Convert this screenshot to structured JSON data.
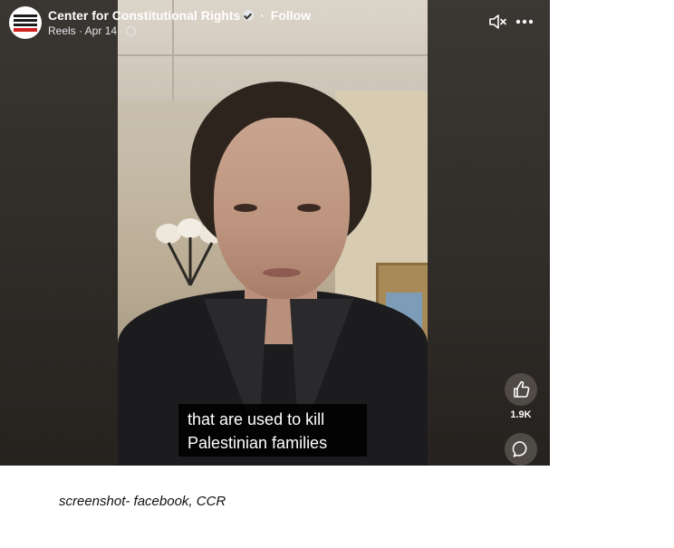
{
  "post": {
    "page_name": "Center for Constitutional Rights",
    "separator": "·",
    "follow_label": "Follow",
    "meta": "Reels · Apr 14 ·",
    "logo_icon": "ccr-logo",
    "verified_icon": "verified-badge-icon",
    "privacy_icon": "globe-icon"
  },
  "controls": {
    "mute_icon": "speaker-muted-icon",
    "more_icon": "more-dots-icon"
  },
  "video": {
    "caption_line1": "that are used to kill",
    "caption_line2": "Palestinian families"
  },
  "actions": {
    "like_icon": "thumbs-up-icon",
    "like_count": "1.9K",
    "comment_icon": "comment-bubble-icon"
  },
  "credit": "screenshot- facebook, CCR",
  "colors": {
    "overlay_text": "#ffffff",
    "caption_background": "#000000"
  }
}
